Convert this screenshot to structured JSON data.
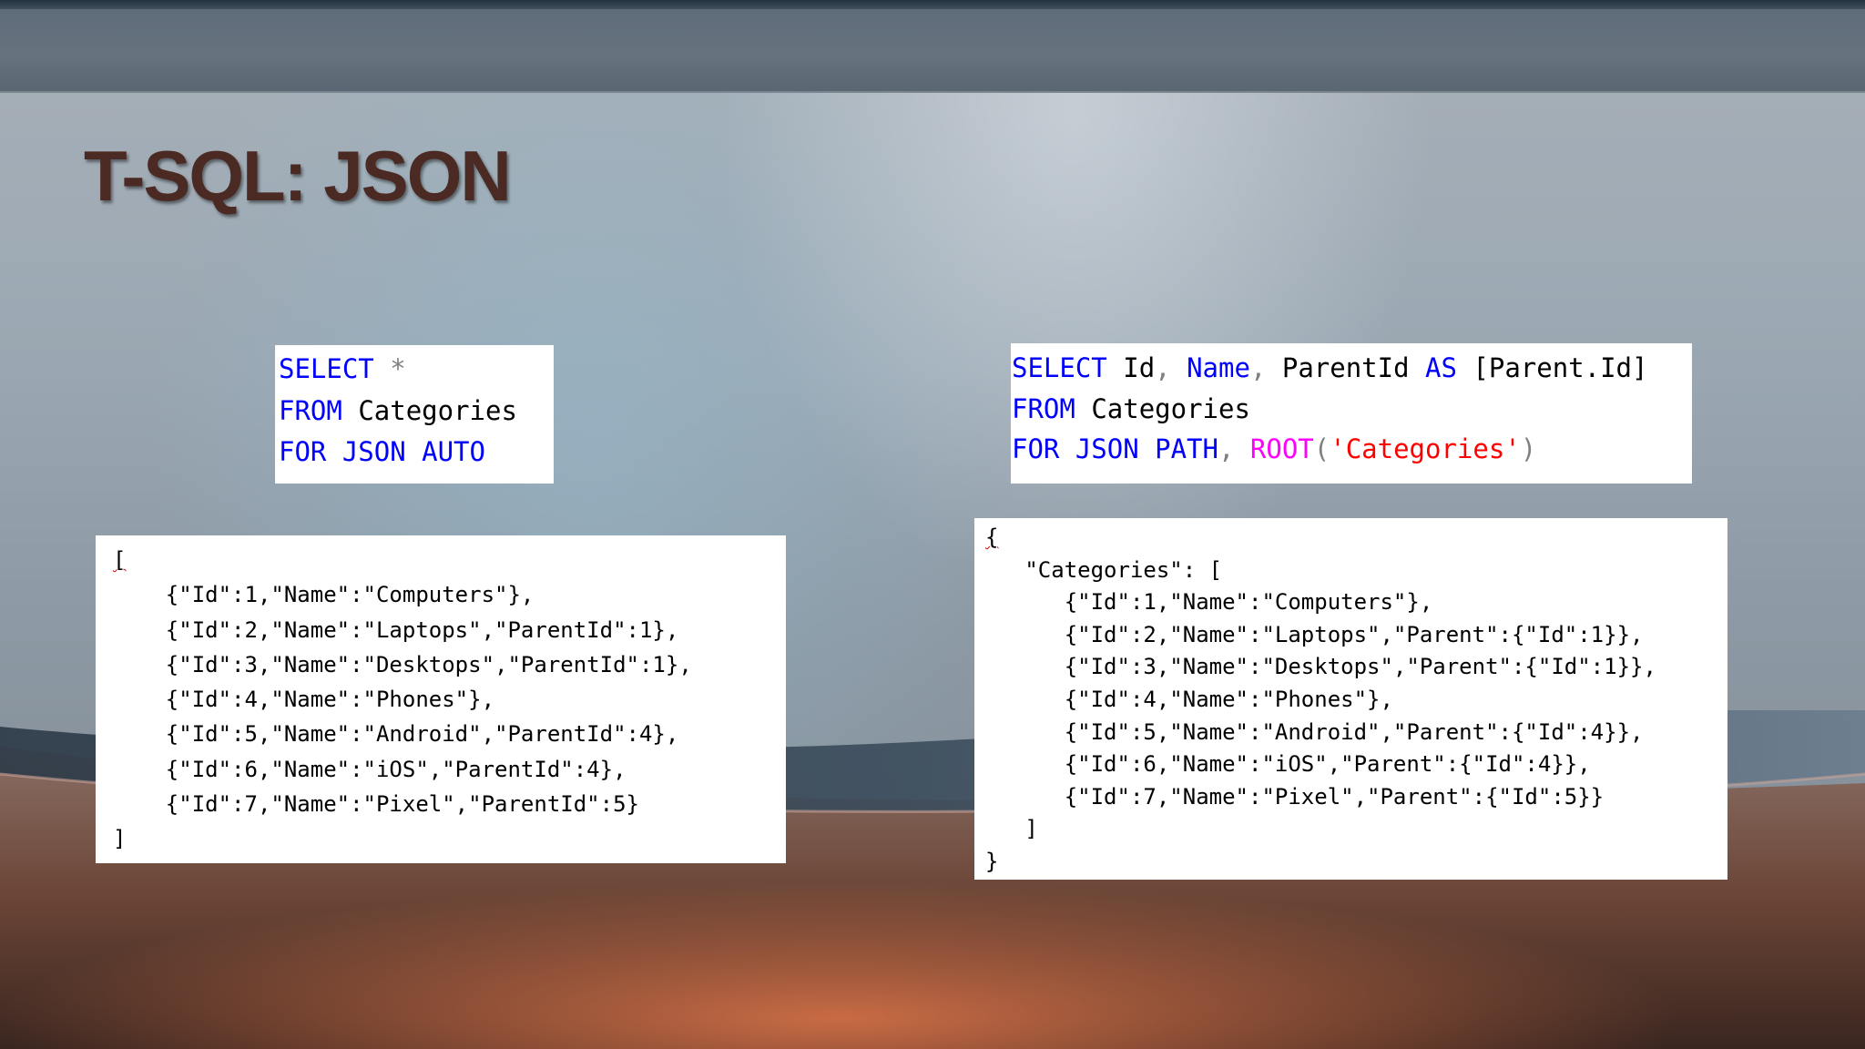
{
  "slide": {
    "title": "T-SQL: JSON"
  },
  "query_auto": {
    "line1": {
      "keyword": "SELECT",
      "star": "*"
    },
    "line2": {
      "keyword": "FROM",
      "table": "Categories"
    },
    "line3": {
      "keyword": "FOR JSON AUTO"
    }
  },
  "query_path": {
    "line1": {
      "select": "SELECT",
      "col1": "Id",
      "comma1": ",",
      "col2": "Name",
      "comma2": ",",
      "col3": "ParentId",
      "as": "AS",
      "alias": "[Parent.Id]"
    },
    "line2": {
      "keyword": "FROM",
      "table": "Categories"
    },
    "line3": {
      "for_json_path": "FOR JSON PATH",
      "comma": ",",
      "root": "ROOT",
      "open_paren": "(",
      "root_name": "'Categories'",
      "close_paren": ")"
    }
  },
  "result_auto": {
    "open": "[",
    "rows": [
      "{\"Id\":1,\"Name\":\"Computers\"},",
      "{\"Id\":2,\"Name\":\"Laptops\",\"ParentId\":1},",
      "{\"Id\":3,\"Name\":\"Desktops\",\"ParentId\":1},",
      "{\"Id\":4,\"Name\":\"Phones\"},",
      "{\"Id\":5,\"Name\":\"Android\",\"ParentId\":4},",
      "{\"Id\":6,\"Name\":\"iOS\",\"ParentId\":4},",
      "{\"Id\":7,\"Name\":\"Pixel\",\"ParentId\":5}"
    ],
    "close": "]"
  },
  "result_path": {
    "open": "{",
    "key_line": "\"Categories\": [",
    "rows": [
      "{\"Id\":1,\"Name\":\"Computers\"},",
      "{\"Id\":2,\"Name\":\"Laptops\",\"Parent\":{\"Id\":1}},",
      "{\"Id\":3,\"Name\":\"Desktops\",\"Parent\":{\"Id\":1}},",
      "{\"Id\":4,\"Name\":\"Phones\"},",
      "{\"Id\":5,\"Name\":\"Android\",\"Parent\":{\"Id\":4}},",
      "{\"Id\":6,\"Name\":\"iOS\",\"Parent\":{\"Id\":4}},",
      "{\"Id\":7,\"Name\":\"Pixel\",\"Parent\":{\"Id\":5}}"
    ],
    "array_close": "]",
    "close": "}"
  },
  "colors": {
    "keyword": "#0000ff",
    "operator": "#808080",
    "string": "#ff0000",
    "function": "#ff00ff",
    "title": "#4a2a22"
  }
}
